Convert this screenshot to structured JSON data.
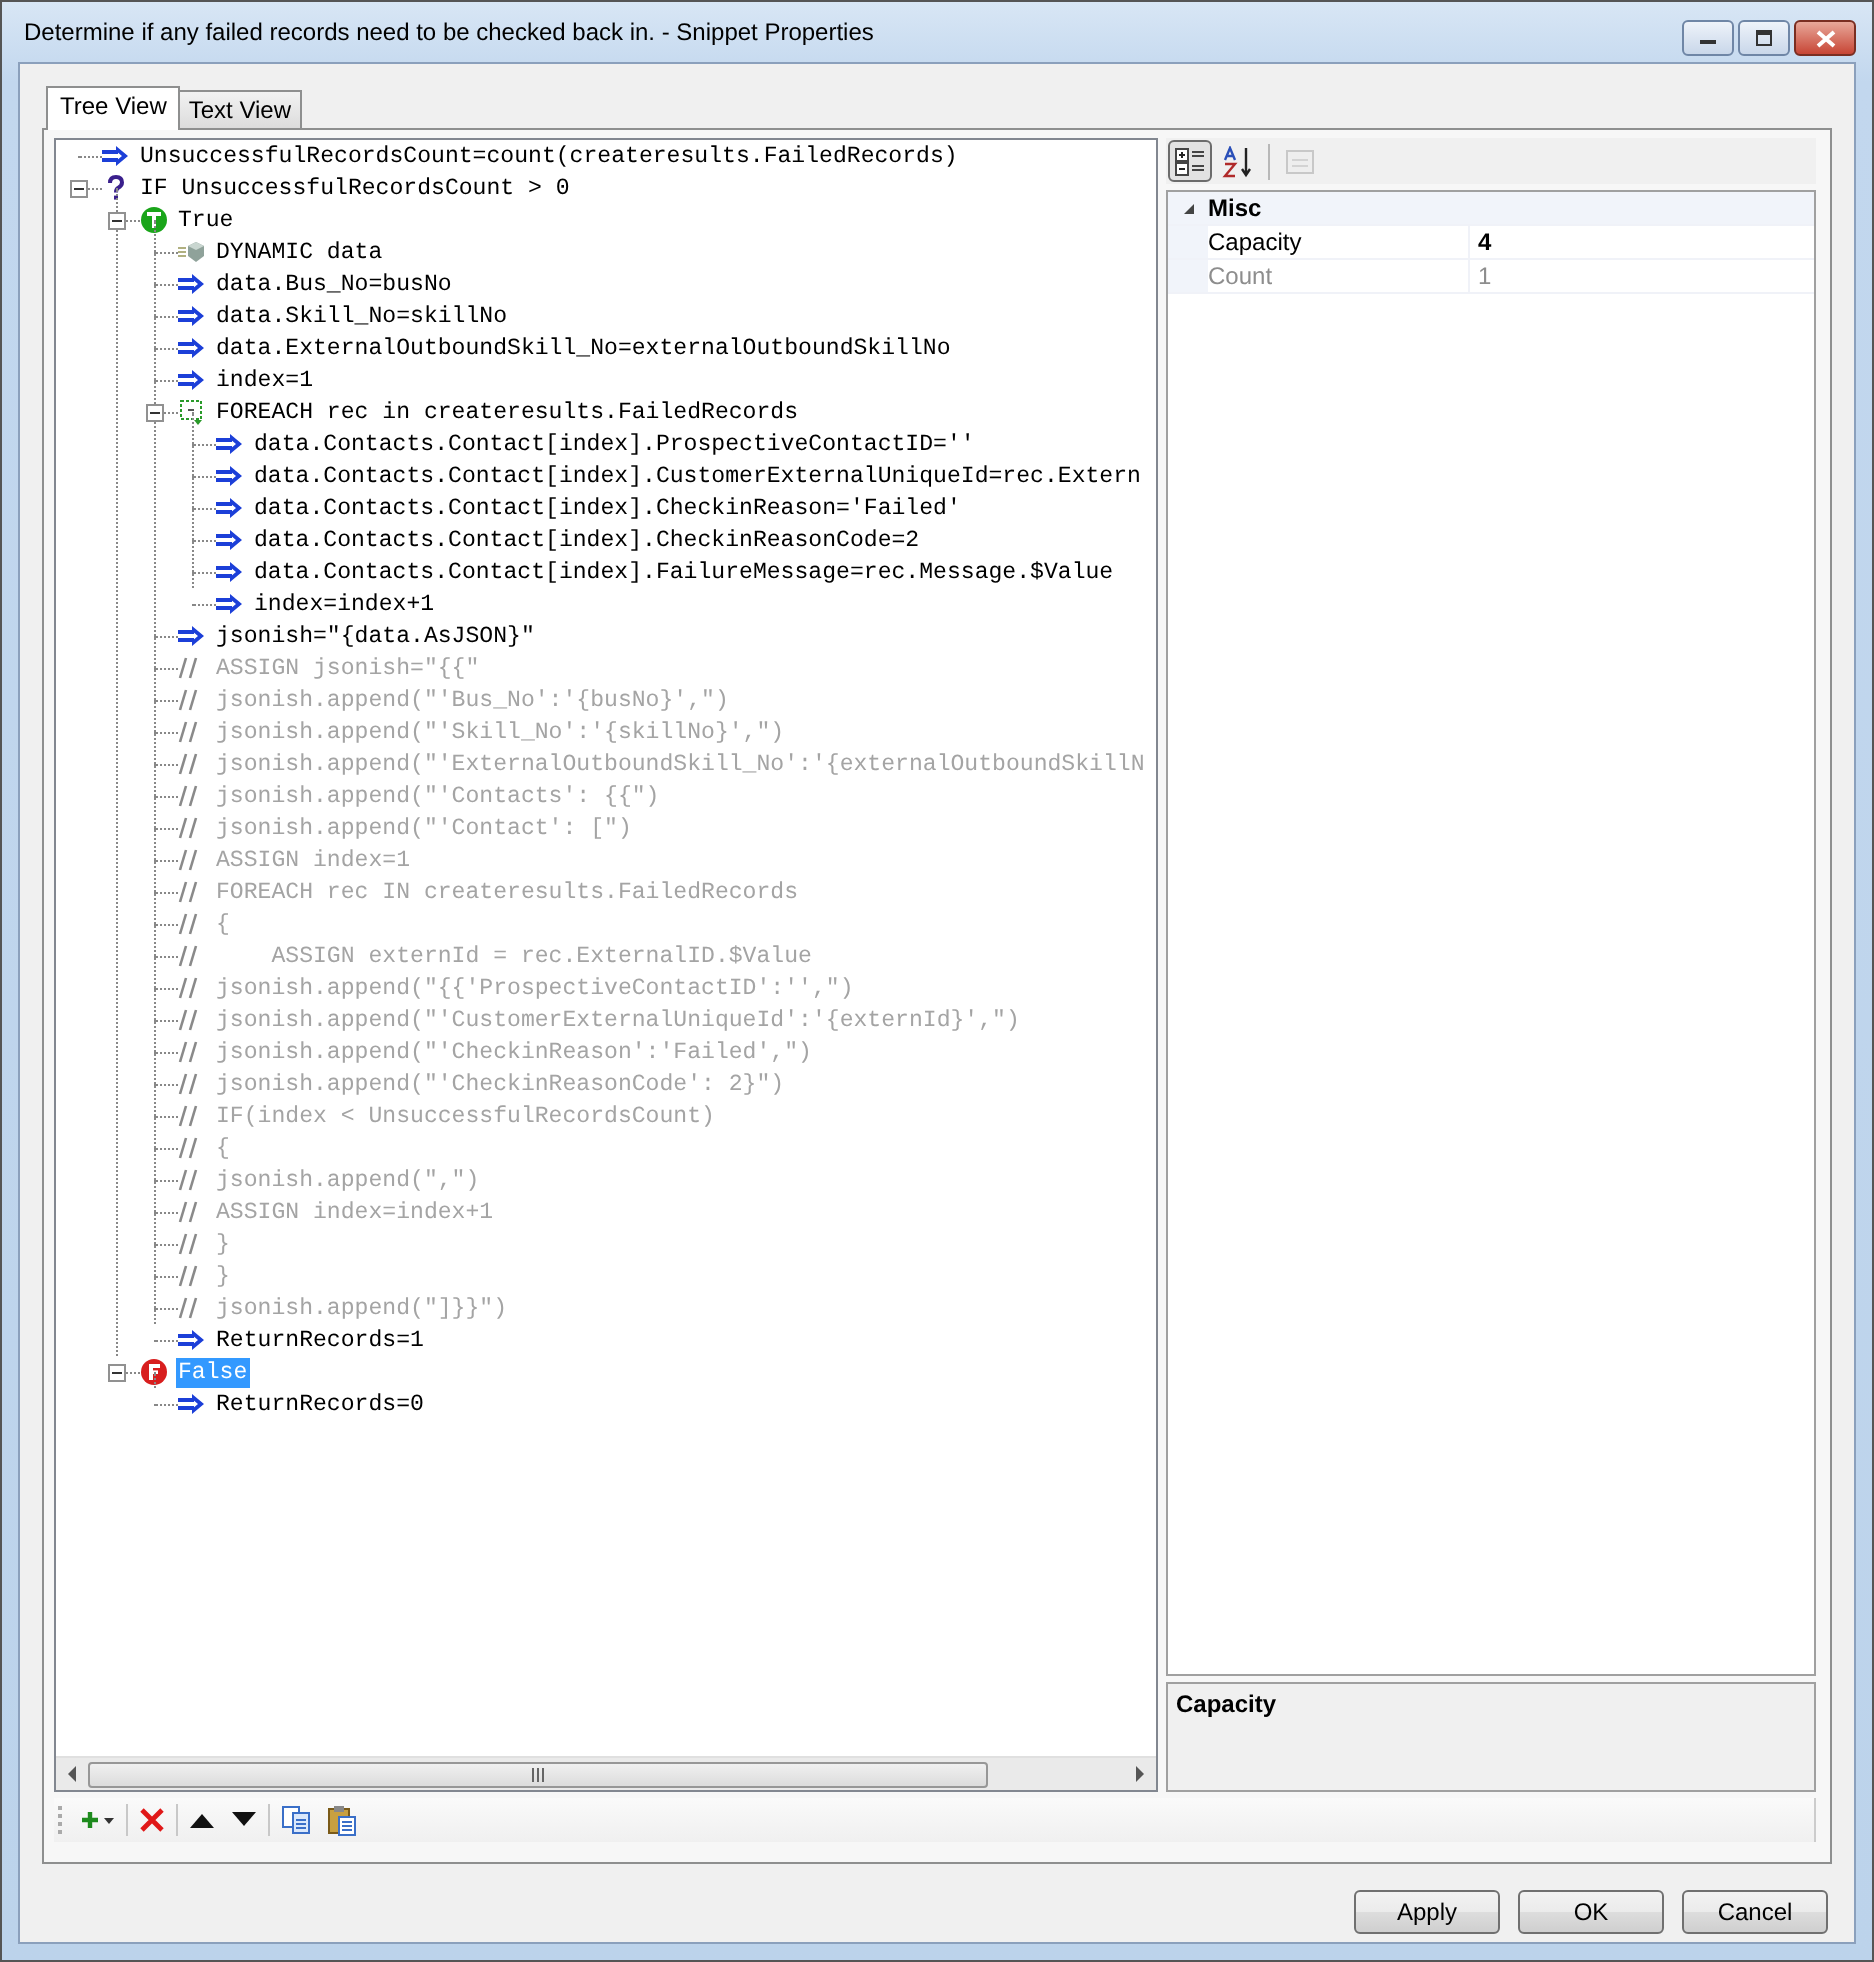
{
  "window": {
    "title": "Determine if any failed records need to be checked back in. - Snippet Properties"
  },
  "tabs": [
    {
      "label": "Tree View",
      "selected": true
    },
    {
      "label": "Text View",
      "selected": false
    }
  ],
  "tree": [
    {
      "kind": "assign",
      "text": "UnsuccessfulRecordsCount=count(createresults.FailedRecords)",
      "selected": false
    },
    {
      "kind": "if",
      "text": "IF UnsuccessfulRecordsCount > 0",
      "selected": false,
      "expanded": true,
      "children": [
        {
          "kind": "true",
          "text": "True",
          "selected": false,
          "expanded": true,
          "children": [
            {
              "kind": "dynamic",
              "text": "DYNAMIC data",
              "selected": false
            },
            {
              "kind": "assign",
              "text": "data.Bus_No=busNo",
              "selected": false
            },
            {
              "kind": "assign",
              "text": "data.Skill_No=skillNo",
              "selected": false
            },
            {
              "kind": "assign",
              "text": "data.ExternalOutboundSkill_No=externalOutboundSkillNo",
              "selected": false
            },
            {
              "kind": "assign",
              "text": "index=1",
              "selected": false
            },
            {
              "kind": "foreach",
              "text": "FOREACH rec in createresults.FailedRecords",
              "selected": false,
              "expanded": true,
              "children": [
                {
                  "kind": "assign",
                  "text": "data.Contacts.Contact[index].ProspectiveContactID=''",
                  "selected": false
                },
                {
                  "kind": "assign",
                  "text": "data.Contacts.Contact[index].CustomerExternalUniqueId=rec.Extern",
                  "selected": false
                },
                {
                  "kind": "assign",
                  "text": "data.Contacts.Contact[index].CheckinReason='Failed'",
                  "selected": false
                },
                {
                  "kind": "assign",
                  "text": "data.Contacts.Contact[index].CheckinReasonCode=2",
                  "selected": false
                },
                {
                  "kind": "assign",
                  "text": "data.Contacts.Contact[index].FailureMessage=rec.Message.$Value",
                  "selected": false
                },
                {
                  "kind": "assign",
                  "text": "index=index+1",
                  "selected": false
                }
              ]
            },
            {
              "kind": "assign",
              "text": "jsonish=\"{data.AsJSON}\"",
              "selected": false
            },
            {
              "kind": "comment",
              "text": "ASSIGN jsonish=\"{{\"",
              "selected": false
            },
            {
              "kind": "comment",
              "text": "jsonish.append(\"'Bus_No':'{busNo}',\")",
              "selected": false
            },
            {
              "kind": "comment",
              "text": "jsonish.append(\"'Skill_No':'{skillNo}',\")",
              "selected": false
            },
            {
              "kind": "comment",
              "text": "jsonish.append(\"'ExternalOutboundSkill_No':'{externalOutboundSkillN",
              "selected": false
            },
            {
              "kind": "comment",
              "text": "jsonish.append(\"'Contacts': {{\")",
              "selected": false
            },
            {
              "kind": "comment",
              "text": "jsonish.append(\"'Contact': [\")",
              "selected": false
            },
            {
              "kind": "comment",
              "text": "ASSIGN index=1",
              "selected": false
            },
            {
              "kind": "comment",
              "text": "FOREACH rec IN createresults.FailedRecords",
              "selected": false
            },
            {
              "kind": "comment",
              "text": "{",
              "selected": false
            },
            {
              "kind": "comment",
              "text": "    ASSIGN externId = rec.ExternalID.$Value",
              "selected": false
            },
            {
              "kind": "comment",
              "text": "jsonish.append(\"{{'ProspectiveContactID':'',\")",
              "selected": false
            },
            {
              "kind": "comment",
              "text": "jsonish.append(\"'CustomerExternalUniqueId':'{externId}',\")",
              "selected": false
            },
            {
              "kind": "comment",
              "text": "jsonish.append(\"'CheckinReason':'Failed',\")",
              "selected": false
            },
            {
              "kind": "comment",
              "text": "jsonish.append(\"'CheckinReasonCode': 2}\")",
              "selected": false
            },
            {
              "kind": "comment",
              "text": "IF(index < UnsuccessfulRecordsCount)",
              "selected": false
            },
            {
              "kind": "comment",
              "text": "{",
              "selected": false
            },
            {
              "kind": "comment",
              "text": "jsonish.append(\",\")",
              "selected": false
            },
            {
              "kind": "comment",
              "text": "ASSIGN index=index+1",
              "selected": false
            },
            {
              "kind": "comment",
              "text": "}",
              "selected": false
            },
            {
              "kind": "comment",
              "text": "}",
              "selected": false
            },
            {
              "kind": "comment",
              "text": "jsonish.append(\"]}}\")",
              "selected": false
            },
            {
              "kind": "assign",
              "text": "ReturnRecords=1",
              "selected": false
            }
          ]
        },
        {
          "kind": "false",
          "text": "False",
          "selected": true,
          "expanded": true,
          "children": [
            {
              "kind": "assign",
              "text": "ReturnRecords=0",
              "selected": false
            }
          ]
        }
      ]
    }
  ],
  "property_toolbar": [
    {
      "kind": "categorized",
      "selected": true,
      "disabled": false
    },
    {
      "kind": "alphabetical",
      "selected": false,
      "disabled": false
    },
    {
      "kind": "pages",
      "selected": false,
      "disabled": true
    }
  ],
  "properties": [
    {
      "category": "Misc",
      "expanded": true,
      "items": [
        {
          "name": "Capacity",
          "value": "4",
          "readonly": false,
          "modified": true
        },
        {
          "name": "Count",
          "value": "1",
          "readonly": true,
          "modified": false
        }
      ]
    }
  ],
  "description": {
    "title": "Capacity"
  },
  "buttons": [
    "Apply",
    "OK",
    "Cancel"
  ]
}
